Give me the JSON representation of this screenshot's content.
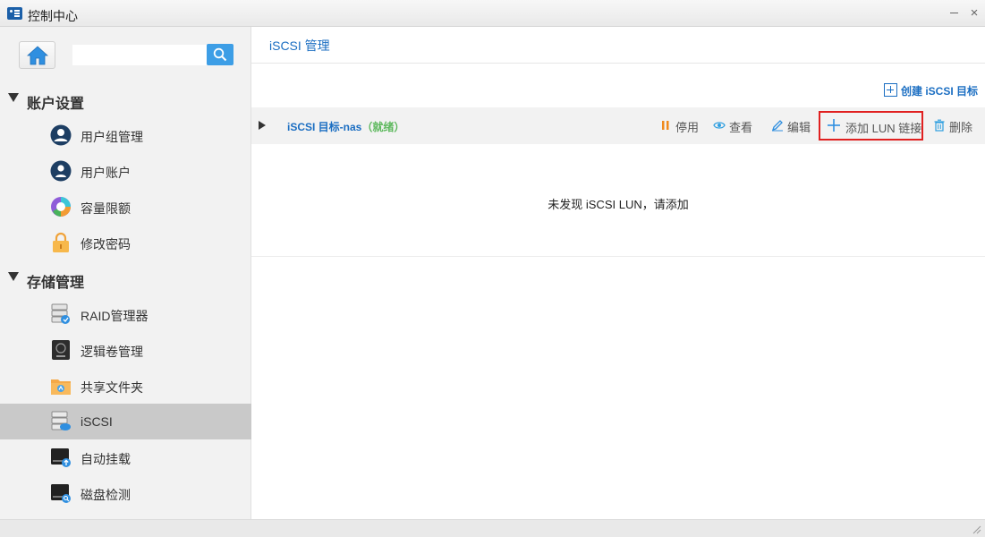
{
  "window": {
    "title": "控制中心",
    "minimize_icon": "minimize-icon",
    "close_icon": "close-icon",
    "close_glyph": "×"
  },
  "sidebar": {
    "search": {
      "placeholder": "",
      "value": ""
    },
    "sections": [
      {
        "label": "账户设置",
        "items": [
          "用户组管理",
          "用户账户",
          "容量限额",
          "修改密码"
        ]
      },
      {
        "label": "存储管理",
        "items": [
          "RAID管理器",
          "逻辑卷管理",
          "共享文件夹",
          "iSCSI",
          "自动挂载",
          "磁盘检测"
        ]
      }
    ],
    "active_item": "iSCSI"
  },
  "main": {
    "title": "iSCSI 管理",
    "create_label": "创建 iSCSI 目标",
    "target": {
      "name": "iSCSI 目标-nas",
      "status": "（就绪）",
      "status_color": "#5cb85c",
      "actions": {
        "stop": "停用",
        "view": "查看",
        "edit": "编辑",
        "add_lun": "添加 LUN 链接",
        "delete": "删除"
      }
    },
    "empty_message": "未发现 iSCSI LUN，请添加"
  },
  "colors": {
    "accent": "#1b6ec2",
    "search_button": "#3d9ee6",
    "highlight_border": "#e02020",
    "active_row": "#c9c9c9"
  }
}
